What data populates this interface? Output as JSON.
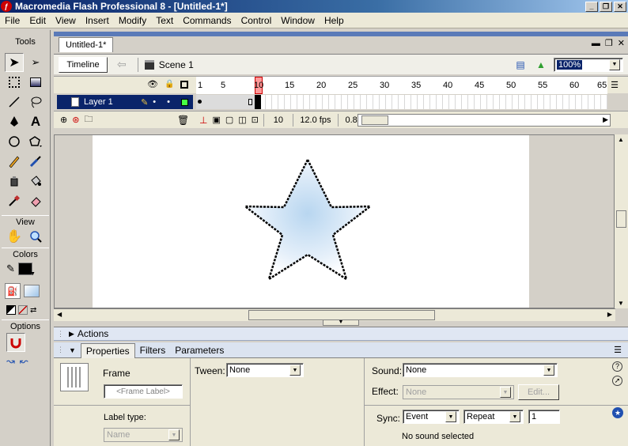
{
  "window": {
    "title": "Macromedia Flash Professional 8 - [Untitled-1*]"
  },
  "menu": [
    "File",
    "Edit",
    "View",
    "Insert",
    "Modify",
    "Text",
    "Commands",
    "Control",
    "Window",
    "Help"
  ],
  "tools": {
    "title": "Tools",
    "view_title": "View",
    "colors_title": "Colors",
    "options_title": "Options",
    "stroke_color": "#000000",
    "fill_color": "#ffffff"
  },
  "document": {
    "tab": "Untitled-1*",
    "timeline_button": "Timeline",
    "scene": "Scene 1",
    "zoom": "100%"
  },
  "timeline": {
    "frame_numbers": [
      "1",
      "5",
      "10",
      "15",
      "20",
      "25",
      "30",
      "35",
      "40",
      "45",
      "50",
      "55",
      "60",
      "65"
    ],
    "layer_name": "Layer 1",
    "current_frame": "10",
    "fps": "12.0 fps",
    "elapsed": "0.8s"
  },
  "panels": {
    "actions": "Actions",
    "tabs": [
      "Properties",
      "Filters",
      "Parameters"
    ],
    "frame_label": "Frame",
    "frame_label_placeholder": "<Frame Label>",
    "label_type_label": "Label type:",
    "label_type_value": "Name",
    "tween_label": "Tween:",
    "tween_value": "None",
    "sound_label": "Sound:",
    "sound_value": "None",
    "effect_label": "Effect:",
    "effect_value": "None",
    "edit_button": "Edit...",
    "sync_label": "Sync:",
    "sync_value": "Event",
    "repeat_value": "Repeat",
    "repeat_count": "1",
    "sound_status": "No sound selected"
  }
}
